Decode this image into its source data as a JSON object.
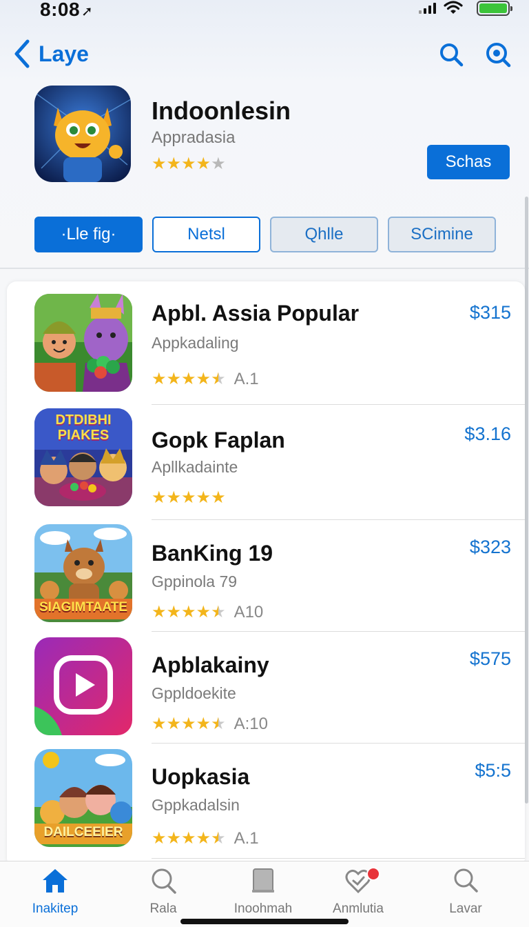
{
  "status_bar": {
    "time": "8:08",
    "location_arrow": "location-arrow-icon"
  },
  "nav": {
    "back_label": "Laye",
    "icons": [
      "search-icon",
      "search-circle-icon"
    ]
  },
  "app": {
    "title": "Indoonlesin",
    "subtitle": "Appradasia",
    "rating": 4,
    "button_label": "Schas"
  },
  "tabs": [
    {
      "label": "·Lle fig·",
      "state": "active"
    },
    {
      "label": "Netsl",
      "state": "outline"
    },
    {
      "label": "Qhlle",
      "state": "muted"
    },
    {
      "label": "SCimine",
      "state": "muted"
    }
  ],
  "list": [
    {
      "title": "Apbl. Assia Popular",
      "subtitle": "Appkadaling",
      "price": "$315",
      "stars": 4.5,
      "rating_text": "A.1",
      "icon_text": ""
    },
    {
      "title": "Gopk Faplan",
      "subtitle": "Apllkadainte",
      "price": "$3.16",
      "stars": 5,
      "rating_text": "",
      "icon_text": "DTDIBHI PIAKES"
    },
    {
      "title": "BanKing 19",
      "subtitle": "Gppinola 79",
      "price": "$323",
      "stars": 4.5,
      "rating_text": "A10",
      "icon_text": "SIAGIMTAATE"
    },
    {
      "title": "Apblakainy",
      "subtitle": "Gppldoekite",
      "price": "$575",
      "stars": 4.5,
      "rating_text": "A:10",
      "icon_text": ""
    },
    {
      "title": "Uopkasia",
      "subtitle": "Gppkadalsin",
      "price": "$5:5",
      "stars": 4.5,
      "rating_text": "A.1",
      "icon_text": "DAILCEEIER"
    }
  ],
  "tab_bar": [
    {
      "label": "Inakitep",
      "icon": "home-icon",
      "active": true
    },
    {
      "label": "Rala",
      "icon": "search-icon",
      "active": false
    },
    {
      "label": "Inoohmah",
      "icon": "tablet-icon",
      "active": false
    },
    {
      "label": "Anmlutia",
      "icon": "heart-check-icon",
      "active": false,
      "badge": true
    },
    {
      "label": "Lavar",
      "icon": "search-icon",
      "active": false
    }
  ],
  "colors": {
    "accent": "#0a6fd8",
    "star": "#f3b51b",
    "badge": "#e8333a"
  }
}
